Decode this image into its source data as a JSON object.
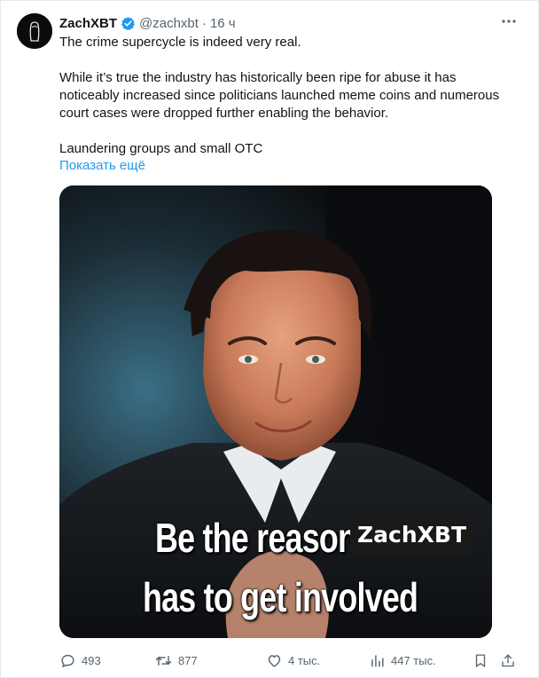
{
  "author": {
    "name": "ZachXBT",
    "handle": "@zachxbt",
    "separator": "·",
    "time": "16 ч",
    "verified": true,
    "verified_color": "#1d9bf0"
  },
  "tweet": {
    "line1": "The crime supercycle is indeed very real.",
    "paragraph2": "While it’s true the industry has historically been ripe for abuse it has noticeably increased since politicians launched meme coins and numerous court cases were dropped further enabling the behavior.",
    "paragraph3": "Laundering groups and small OTC",
    "show_more": "Показать ещё"
  },
  "media": {
    "caption_line1": "Be the reason",
    "caption_name": "ZachXBT",
    "caption_line2": "has to get involved"
  },
  "actions": {
    "replies": "493",
    "reposts": "877",
    "likes": "4 тыс.",
    "views": "447 тыс."
  },
  "icons": {
    "more": "more-horizontal-icon",
    "reply": "reply-icon",
    "repost": "repost-icon",
    "like": "heart-icon",
    "views": "views-chart-icon",
    "bookmark": "bookmark-icon",
    "share": "share-icon"
  },
  "colors": {
    "accent": "#1d9bf0",
    "muted": "#536471",
    "text": "#0f1419"
  }
}
